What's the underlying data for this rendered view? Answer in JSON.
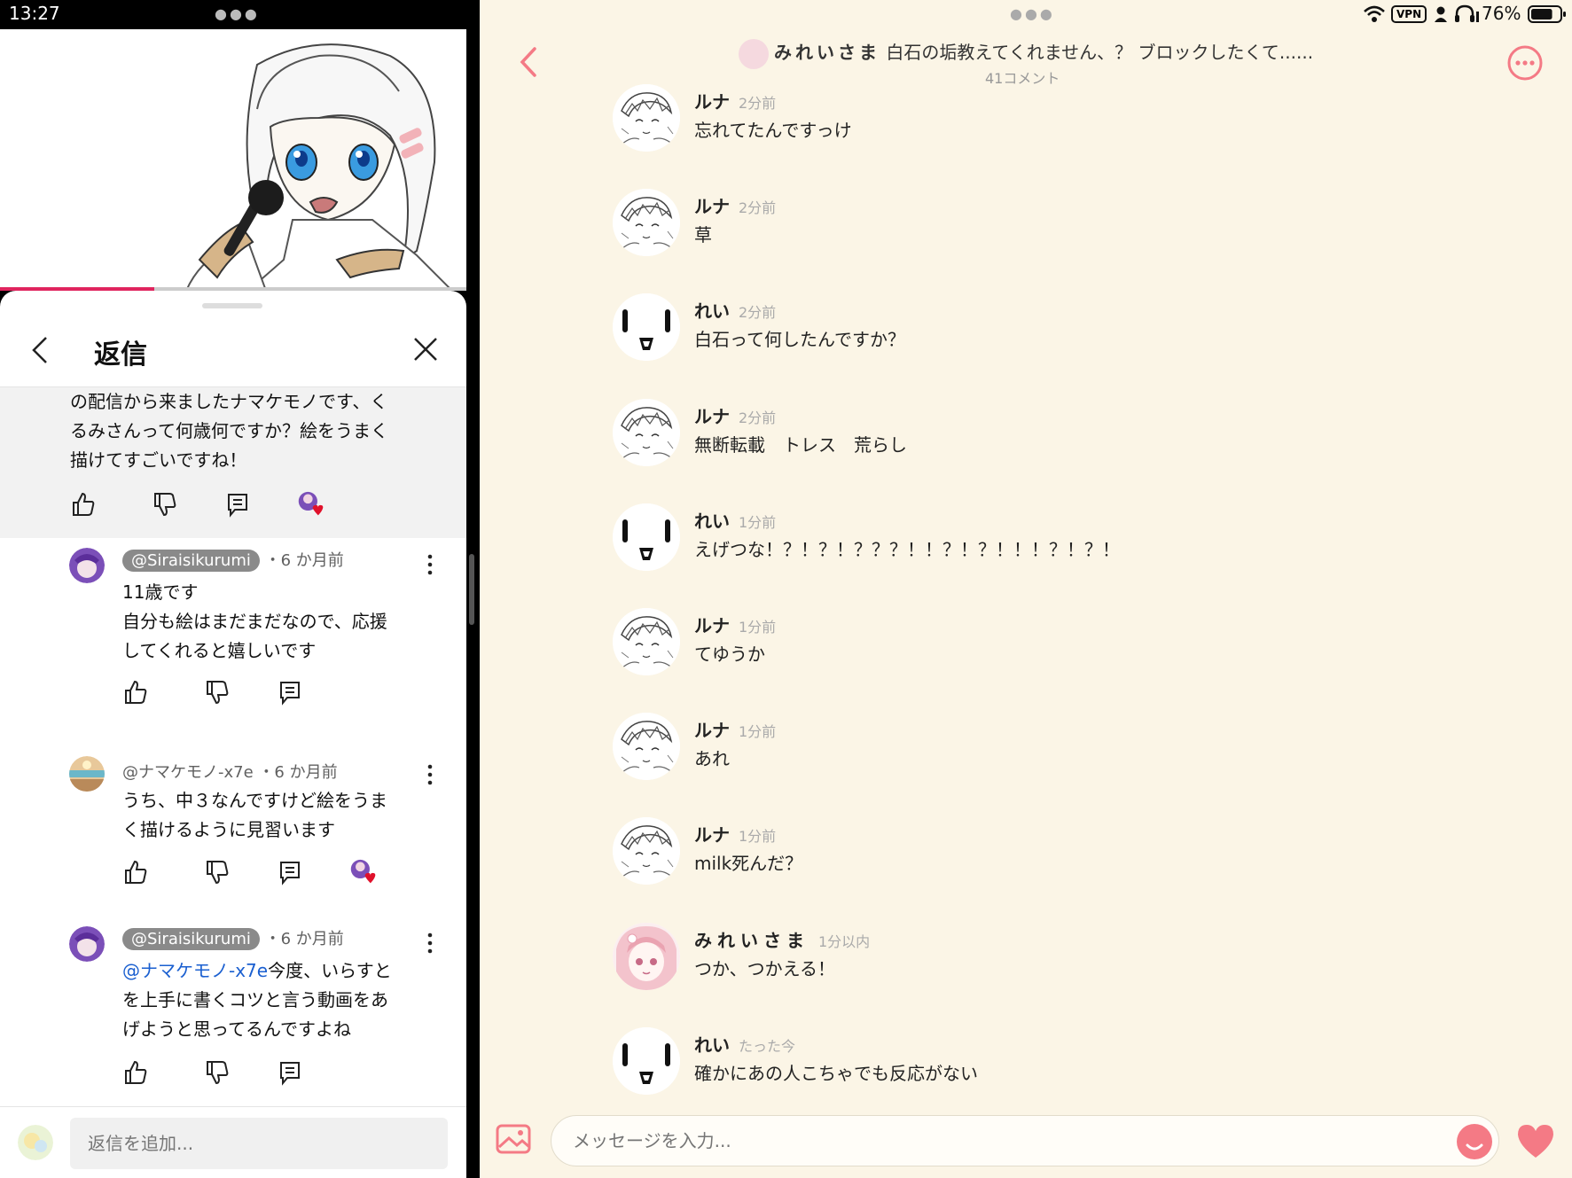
{
  "status": {
    "time": "13:27",
    "vpn": "VPN",
    "battery": "76%",
    "battery_level": 0.76
  },
  "video": {
    "progress": 0.33
  },
  "replies_panel": {
    "title": "返信",
    "parent_comment": {
      "lines": [
        "の配信から来ましたナマケモノです、く",
        "るみさんって何歳何ですか？絵をうまく",
        "描けてすごいですね！"
      ]
    },
    "comments": [
      {
        "handle": "@Siraisikurumi",
        "time": "・6 か月前",
        "pill": true,
        "lines": [
          "11歳です",
          "自分も絵はまだまだなので、応援",
          "してくれると嬉しいです"
        ],
        "heart": false
      },
      {
        "handle": "@ナマケモノ-x7e",
        "time": "・6 か月前",
        "pill": false,
        "lines": [
          "うち、中３なんですけど絵をうま",
          "く描けるように見習います"
        ],
        "heart": true
      },
      {
        "handle": "@Siraisikurumi",
        "time": "・6 か月前",
        "pill": true,
        "mention": "@ナマケモノ-x7e",
        "lines": [
          "今度、いらすと",
          "を上手に書くコツと言う動画をあ",
          "げようと思ってるんですよね"
        ],
        "heart": false
      }
    ],
    "reply_placeholder": "返信を追加..."
  },
  "chat": {
    "owner": "みれいさま",
    "title": "白石の垢教えてくれません、？ ブロックしたくて......",
    "subtitle": "41コメント",
    "messages": [
      {
        "name": "ルナ",
        "time": "2分前",
        "text": "忘れてたんですっけ",
        "avatar": "sketch"
      },
      {
        "name": "ルナ",
        "time": "2分前",
        "text": "草",
        "avatar": "sketch"
      },
      {
        "name": "れい",
        "time": "2分前",
        "text": "白石って何したんですか？",
        "avatar": "face"
      },
      {
        "name": "ルナ",
        "time": "2分前",
        "text": "無断転載　トレス　荒らし",
        "avatar": "sketch"
      },
      {
        "name": "れい",
        "time": "1分前",
        "text": "えげつな！？！？！？？？！！？！？！！！？！？！",
        "avatar": "face"
      },
      {
        "name": "ルナ",
        "time": "1分前",
        "text": "てゆうか",
        "avatar": "sketch"
      },
      {
        "name": "ルナ",
        "time": "1分前",
        "text": "あれ",
        "avatar": "sketch"
      },
      {
        "name": "ルナ",
        "time": "1分前",
        "text": "milk死んだ？",
        "avatar": "sketch"
      },
      {
        "name": "みれいさま",
        "time": "1分以内",
        "text": "つか、つかえる！",
        "avatar": "pink"
      },
      {
        "name": "れい",
        "time": "たった今",
        "text": "確かにあの人こちゃでも反応がない",
        "avatar": "face"
      }
    ],
    "input_placeholder": "メッセージを入力...",
    "accent": "#f47a85"
  }
}
